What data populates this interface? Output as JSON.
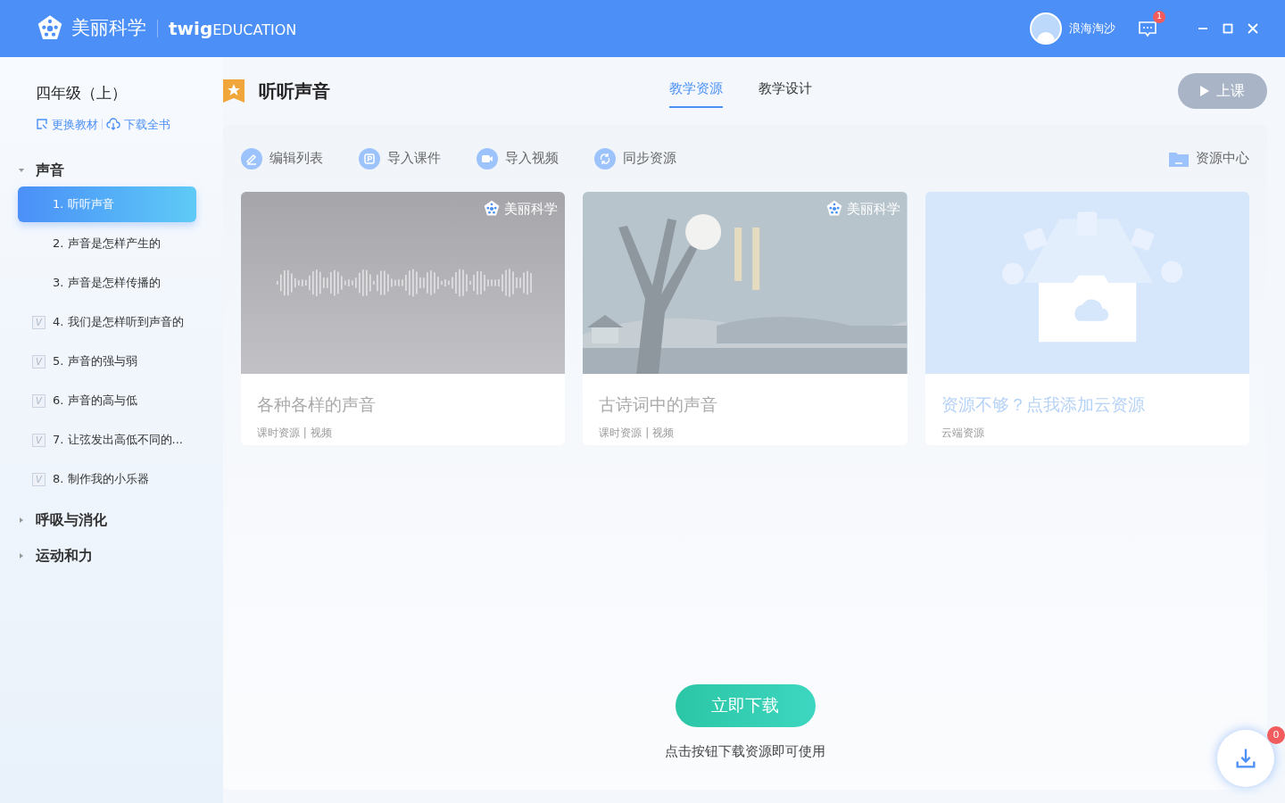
{
  "header": {
    "brand": "美丽科学",
    "partner": "twig",
    "partner_suffix": "EDUCATION",
    "user": "浪海淘沙",
    "message_count": "1"
  },
  "sidebar": {
    "grade": "四年级（上）",
    "links": [
      "更换教材",
      "下载全书"
    ],
    "chapters": [
      {
        "title": "声音",
        "expanded": true,
        "lessons": [
          {
            "title": "1. 听听声音",
            "selected": true
          },
          {
            "title": "2. 声音是怎样产生的",
            "selected": false
          },
          {
            "title": "3. 声音是怎样传播的",
            "selected": false
          },
          {
            "title": "4. 我们是怎样听到声音的",
            "selected": false,
            "mark": "V"
          },
          {
            "title": "5. 声音的强与弱",
            "selected": false,
            "mark": "V"
          },
          {
            "title": "6. 声音的高与低",
            "selected": false,
            "mark": "V"
          },
          {
            "title": "7. 让弦发出高低不同的...",
            "selected": false,
            "mark": "V"
          },
          {
            "title": "8. 制作我的小乐器",
            "selected": false,
            "mark": "V"
          }
        ]
      },
      {
        "title": "呼吸与消化",
        "expanded": false
      },
      {
        "title": "运动和力",
        "expanded": false
      }
    ]
  },
  "lesson_title": "听听声音",
  "tabs": [
    {
      "label": "教学资源",
      "selected": true
    },
    {
      "label": "教学设计",
      "selected": false
    }
  ],
  "start_button": {
    "label": "上课",
    "disabled": true
  },
  "toolbar": [
    {
      "label": "编辑列表",
      "kind": "edit"
    },
    {
      "label": "导入课件",
      "kind": "ppt"
    },
    {
      "label": "导入视频",
      "kind": "video"
    },
    {
      "label": "同步资源",
      "kind": "sync"
    }
  ],
  "resource_center": "资源中心",
  "cards": [
    {
      "kind": "audio",
      "brand": "美丽科学",
      "title": "各种各样的声音",
      "meta": "课时资源 | 视频"
    },
    {
      "kind": "picture",
      "brand": "美丽科学",
      "title": "古诗词中的声音",
      "meta": "课时资源 | 视频"
    },
    {
      "kind": "cloud",
      "title": "资源不够？点我添加云资源",
      "meta": "云端资源"
    }
  ],
  "download": {
    "button": "立即下载",
    "hint": "点击按钮下载资源即可使用",
    "count": "0"
  }
}
